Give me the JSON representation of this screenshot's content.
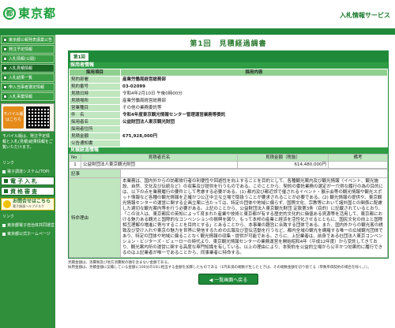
{
  "header": {
    "logo_mark": "都",
    "logo_text": "東京都",
    "site_title": "入札情報サービス"
  },
  "sidebar": {
    "items": [
      {
        "label": "東京都公報発表講業公告"
      },
      {
        "label": "発注予定情報"
      },
      {
        "label": "入札情報(公開)"
      },
      {
        "label": "入札見積情報"
      },
      {
        "label": "入札結果一覧"
      },
      {
        "label": "申入当事者選定情報"
      },
      {
        "label": "入札事業情報"
      }
    ],
    "mobile_label_1": "モバイル版",
    "mobile_label_2": "はこちら",
    "note": "モバイル版は、発注予定情報と入札(見積)結果情報をご覧いただけます。",
    "heading_links": "リンク",
    "link_sys": "電子調達システム(TOP)",
    "big1": "電子入札",
    "big2": "資格審査",
    "help_a": "お問合せはこちら",
    "help_b": "電子調達ヘルプデスク",
    "heading_other": "リンク",
    "link_a": "東京都電子自治体共同運営",
    "link_b": "東京都公式ホームページ"
  },
  "main": {
    "page_title": "第1回　見積経過調書",
    "tab": "第1回",
    "section1": "採用者情報",
    "head_item": "採用項目",
    "head_content": "採用内容",
    "rows": [
      {
        "label": "契約部署",
        "value": "産業労働局経営総務部"
      },
      {
        "label": "契約番号",
        "value": "03-02099"
      },
      {
        "label": "見積日時",
        "value": "令和4年2月10日 午後0時00分"
      },
      {
        "label": "見積場所",
        "value": "産業労働局経営総務部"
      },
      {
        "label": "営業種目",
        "value": "その他の業務委託等"
      },
      {
        "label": "件　名",
        "value": "令和4年度東京観光情報センター管理運営業務等委託"
      },
      {
        "label": "採用者名",
        "value": "公益財団法人東京観光財団"
      },
      {
        "label": "採用者住所",
        "value": ""
      },
      {
        "label": "見積金額",
        "value": "675,928,000円"
      },
      {
        "label": "公告通知書",
        "value": ""
      }
    ],
    "section2": "見積経過情報",
    "t2_headers": {
      "no": "No",
      "name": "見積者氏名",
      "amount": "見積金額（税抜）",
      "remark": "備考"
    },
    "t2_row": {
      "no": "1",
      "name": "公益財団法人東京観光財団",
      "amount": "614,480,000円",
      "remark": ""
    },
    "kiroku_label": "記事",
    "special_label": "特命理由",
    "special_text": "本業務は、国内外からの訪都旅行者の利便性や回遊性を向上することを目的として、各種観光案内及び観光情報（イベント、観光施設、自然、文化及び伝統など）の収集及び提供を行うものである。このことから、契約の委託業務の選定が一穴得な履行の為の目的には、以下の点を業務履行の要件として考慮する必要がある。(1) 都内及び都近郊で催されるイベント・展示会等の観光情報や観光スポット情報など各種の観光情報を正確かつ公正中立な立場で取扱うことが要求されることが必要である。(2) 観光情報の提供や、東京観光情報センターの運営に関する企画立案に当たっては、特定の団体や地域に偏らず、国際文化、宗教等において諸外国との関係に配慮した適切な観光案内等を行う必要がある。上記のことから、公益財団法人東京観光財団 定款第3条（目的）に記載されているとおり、「この法人は、東京都民の英知によって育まれた産業や技術と東京都が有する歴史的文化的に価値ある資源等を活用して、東京都における魅力ある観光と国際的なコンベンションの振興を図り、もって本邦の産業と経済を活性化させるとともに、国民文化の向上と国際相互理解の増進に寄与することを目的とする」とあることから、本事業の趣旨に合致する団体である。また、国内外からの観光客の誘致及び受け入れや東京の魅力を世界に発信するための広報及び宣伝活動を行うなど、都内全域の観光を網羅する唯一の広域観光団体であり、特定の団体や地域に偏ることなく観光情報の収集・提供が可能である。さらに、上記業者は、前身である社団法人東京コンベンション・ビジターズ・ビューローの時代より、東京観光情報センターの業務運営を開始昭和4年（平成12年度）から受託してきており、観光案内所の運営に関する高度な専門知識を有している。以上の理由により、本契約を公益的立場から公平かつ効果的に履行できるのは上記業者が唯一であることから、同事業者に特命する。",
    "footnote1": "見積金額は、消費税及び地方消費税の額を含まない金額である。",
    "footnote2": "採用金額は、見積金額に記載している金額に100分の10に相当する金額を加算したものである（1円未満の端数が生じたときは、その端数金額を切り捨てる（単数単価契約の場合を除く。））。",
    "back_label": "◀ 一覧画面へ戻る"
  }
}
